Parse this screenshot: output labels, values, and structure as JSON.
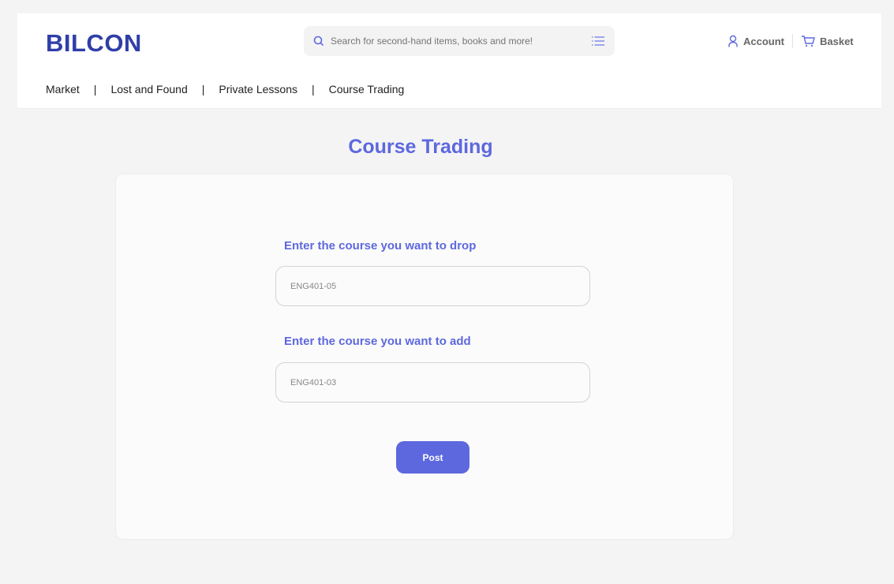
{
  "header": {
    "logo": "BILCON",
    "search_placeholder": "Search for second-hand items, books and more!",
    "account": "Account",
    "basket": "Basket"
  },
  "nav": [
    "Market",
    "Lost and Found",
    "Private Lessons",
    "Course Trading"
  ],
  "nav_sep": "|",
  "page": {
    "title": "Course Trading",
    "drop_label": "Enter the course you want to drop",
    "drop_value": "ENG401-05",
    "add_label": "Enter the course you want to add",
    "add_value": "ENG401-03",
    "post": "Post"
  }
}
